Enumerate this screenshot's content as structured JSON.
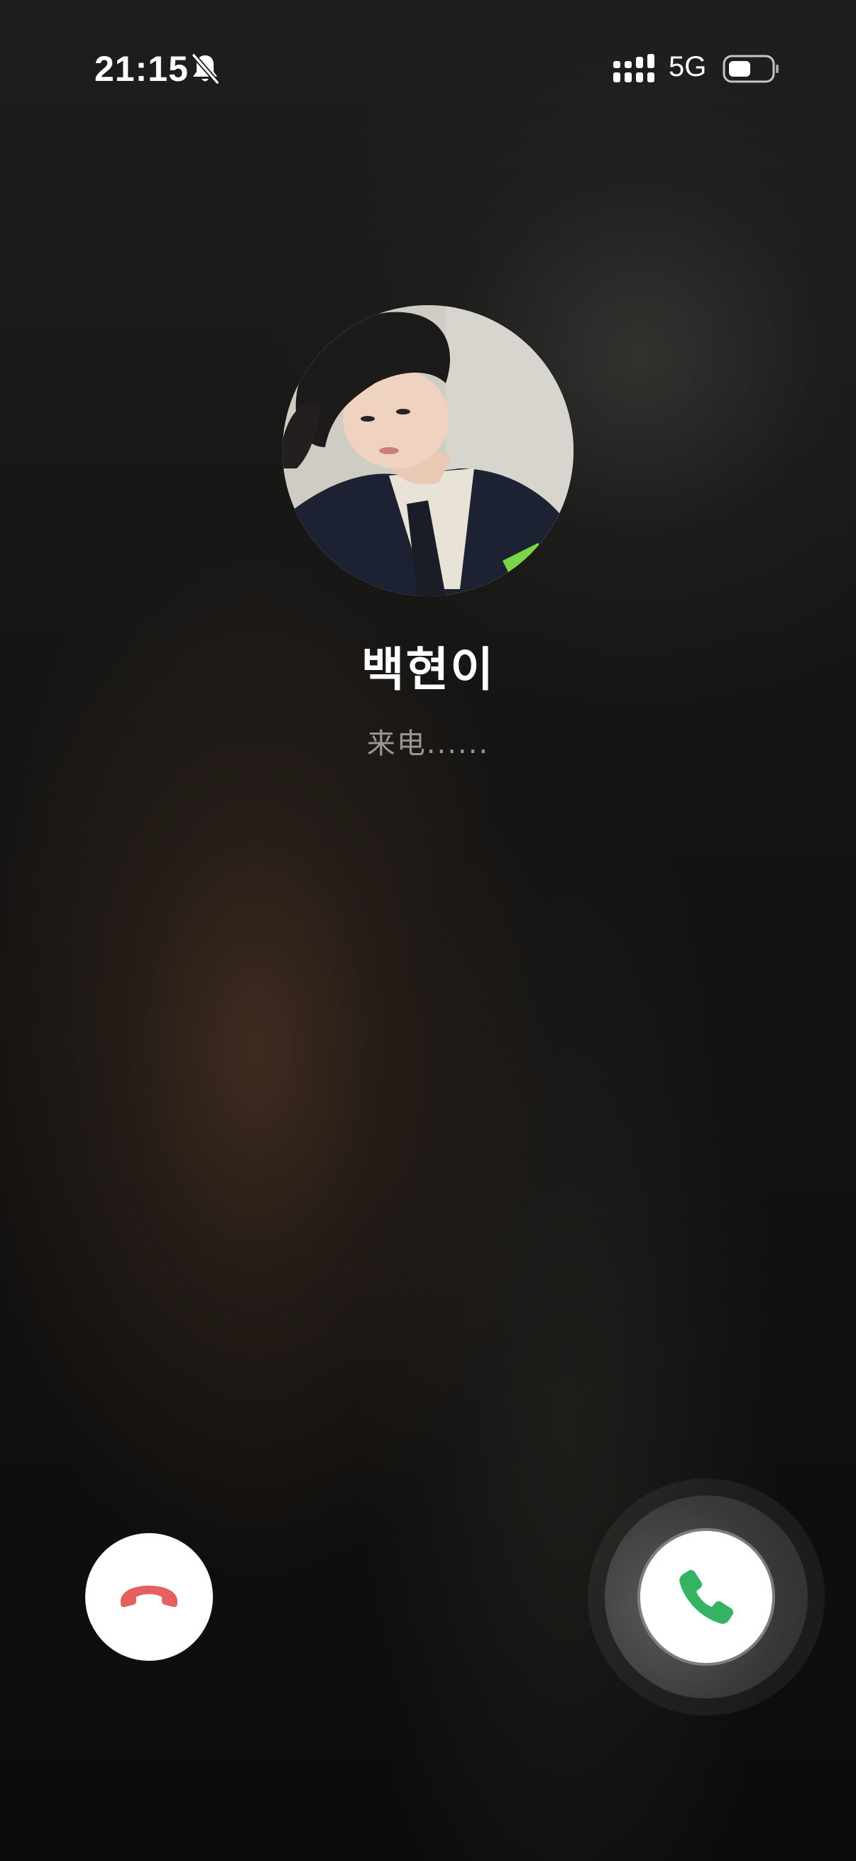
{
  "status_bar": {
    "time": "21:15",
    "network": "5G",
    "icons": [
      "bell-off-icon",
      "signal-icon",
      "battery-icon"
    ]
  },
  "caller": {
    "name": "백현이",
    "status": "来电......"
  },
  "actions": {
    "decline_icon": "phone-hangup-icon",
    "accept_icon": "phone-icon",
    "decline_color": "#e5605f",
    "accept_color": "#34b463"
  }
}
